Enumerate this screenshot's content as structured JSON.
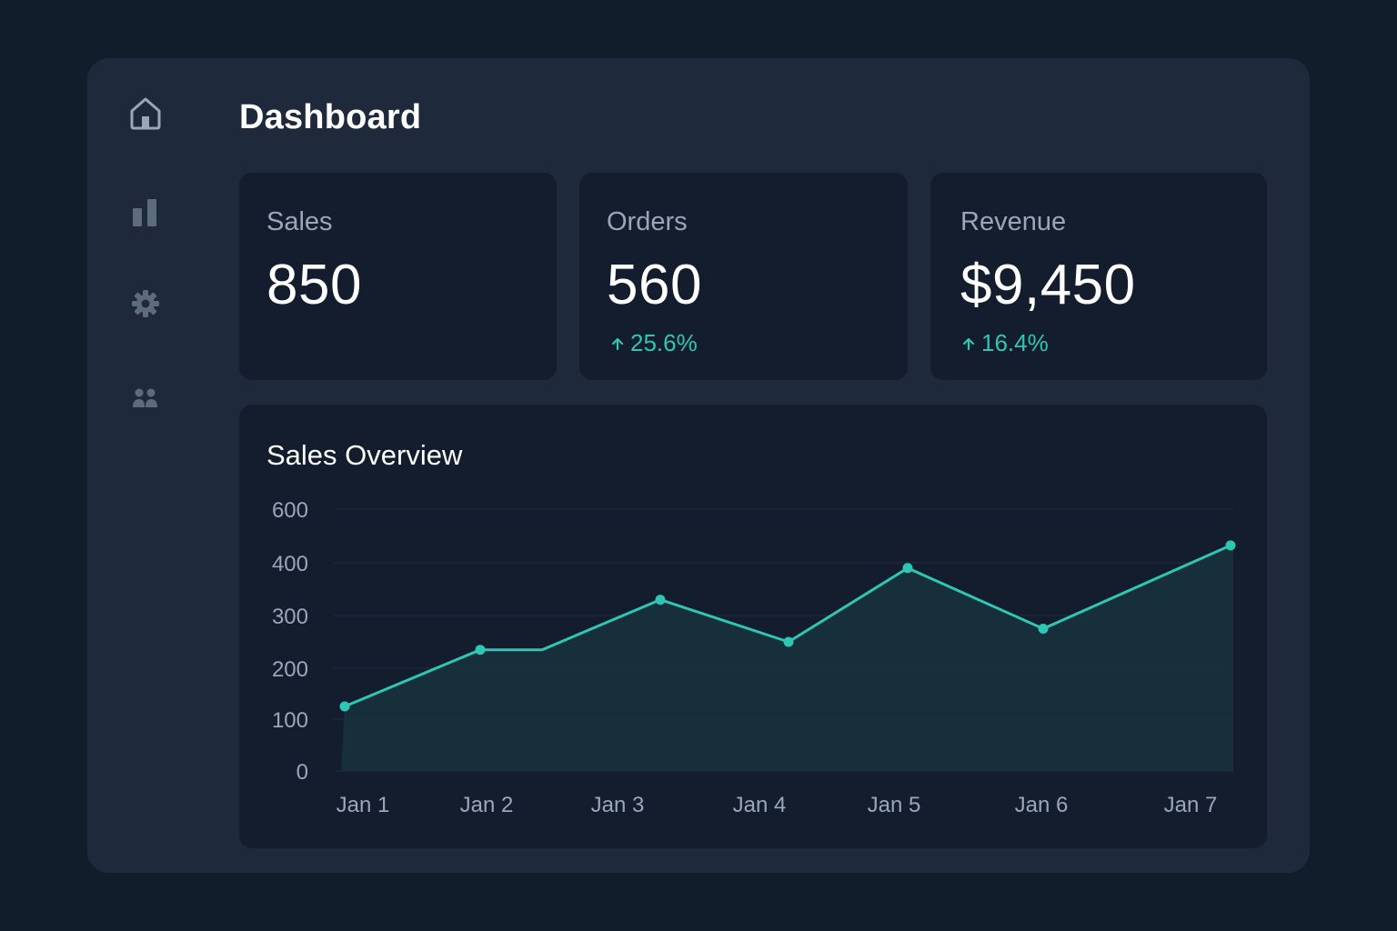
{
  "nav": {
    "items": [
      {
        "icon": "home-icon",
        "active": true
      },
      {
        "icon": "bar-chart-icon",
        "active": false
      },
      {
        "icon": "gear-icon",
        "active": false
      },
      {
        "icon": "users-icon",
        "active": false
      }
    ]
  },
  "header": {
    "title": "Dashboard"
  },
  "stats": {
    "sales": {
      "label": "Sales",
      "value": "850"
    },
    "orders": {
      "label": "Orders",
      "value": "560",
      "delta": "25.6%",
      "delta_direction": "up"
    },
    "revenue": {
      "label": "Revenue",
      "value": "$9,450",
      "delta": "16.4%",
      "delta_direction": "up"
    }
  },
  "colors": {
    "accent": "#2ec6b4",
    "background": "#121d2b",
    "panel": "#1e2a3c",
    "card": "#131d2d",
    "muted_text": "#9aa7ba"
  },
  "chart_data": {
    "type": "area",
    "title": "Sales Overview",
    "xlabel": "",
    "ylabel": "",
    "categories": [
      "Jan 1",
      "Jan 2",
      "Jan 3",
      "Jan 4",
      "Jan 5",
      "Jan 6",
      "Jan 7"
    ],
    "y_ticks": [
      "0",
      "100",
      "200",
      "300",
      "400",
      "600"
    ],
    "grid": true,
    "legend": "none",
    "points": [
      {
        "x": "Jan 1",
        "y": 125
      },
      {
        "x": "Jan 2",
        "y": 235
      },
      {
        "x": "Jan 2",
        "y": 235,
        "marker": false
      },
      {
        "x": "Jan 3",
        "y": 330
      },
      {
        "x": "Jan 4",
        "y": 250
      },
      {
        "x": "Jan 5",
        "y": 390
      },
      {
        "x": "Jan 6",
        "y": 275
      },
      {
        "x": "Jan 7",
        "y": 465
      }
    ]
  }
}
